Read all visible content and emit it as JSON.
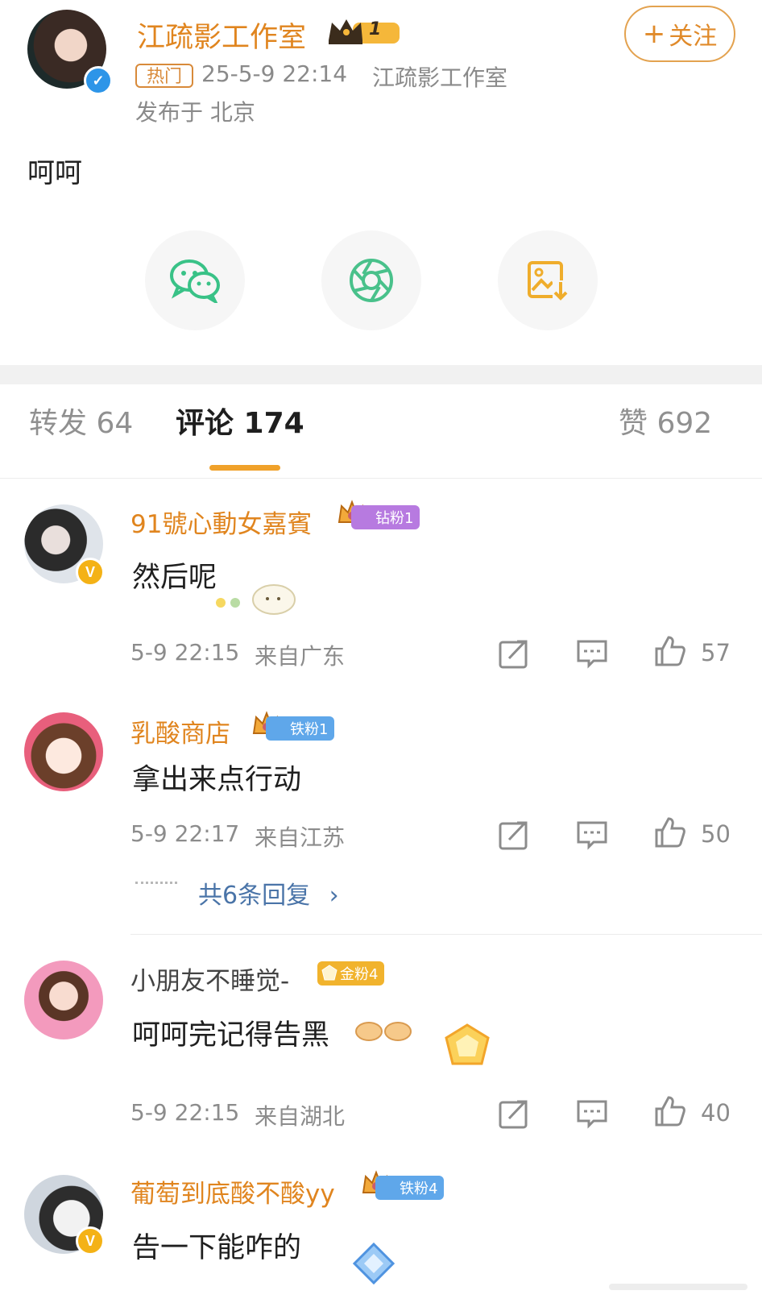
{
  "post": {
    "author": "江疏影工作室",
    "level": "1",
    "hot_tag": "热门",
    "timestamp": "25-5-9 22:14",
    "source": "江疏影工作室",
    "location": "发布于 北京",
    "follow_label": "关注",
    "body": "呵呵"
  },
  "share_icons": [
    "wechat-icon",
    "moments-icon",
    "save-image-icon"
  ],
  "tabs": {
    "repost": "转发 64",
    "comments": "评论 174",
    "likes": "赞 692"
  },
  "comments": [
    {
      "user": "91號心動女嘉賓",
      "badge": "钻粉1",
      "text": "然后呢",
      "time": "5-9 22:15",
      "region": "来自广东",
      "likes": "57"
    },
    {
      "user": "乳酸商店",
      "badge": "铁粉1",
      "text": "拿出来点行动",
      "time": "5-9 22:17",
      "region": "来自江苏",
      "likes": "50",
      "replies": "共6条回复"
    },
    {
      "user": "小朋友不睡觉-",
      "badge": "金粉4",
      "text": "呵呵完记得告黑",
      "time": "5-9 22:15",
      "region": "来自湖北",
      "likes": "40"
    },
    {
      "user": "葡萄到底酸不酸yy",
      "badge": "铁粉4",
      "text": "告一下能咋的"
    }
  ],
  "colors": {
    "accent_orange": "#e0851f",
    "verified_blue": "#2d95e8",
    "verified_gold": "#f4b216",
    "diamond_fan": "#b77ae0",
    "iron_fan": "#5fa7ea",
    "gold_fan": "#f1b32d"
  }
}
